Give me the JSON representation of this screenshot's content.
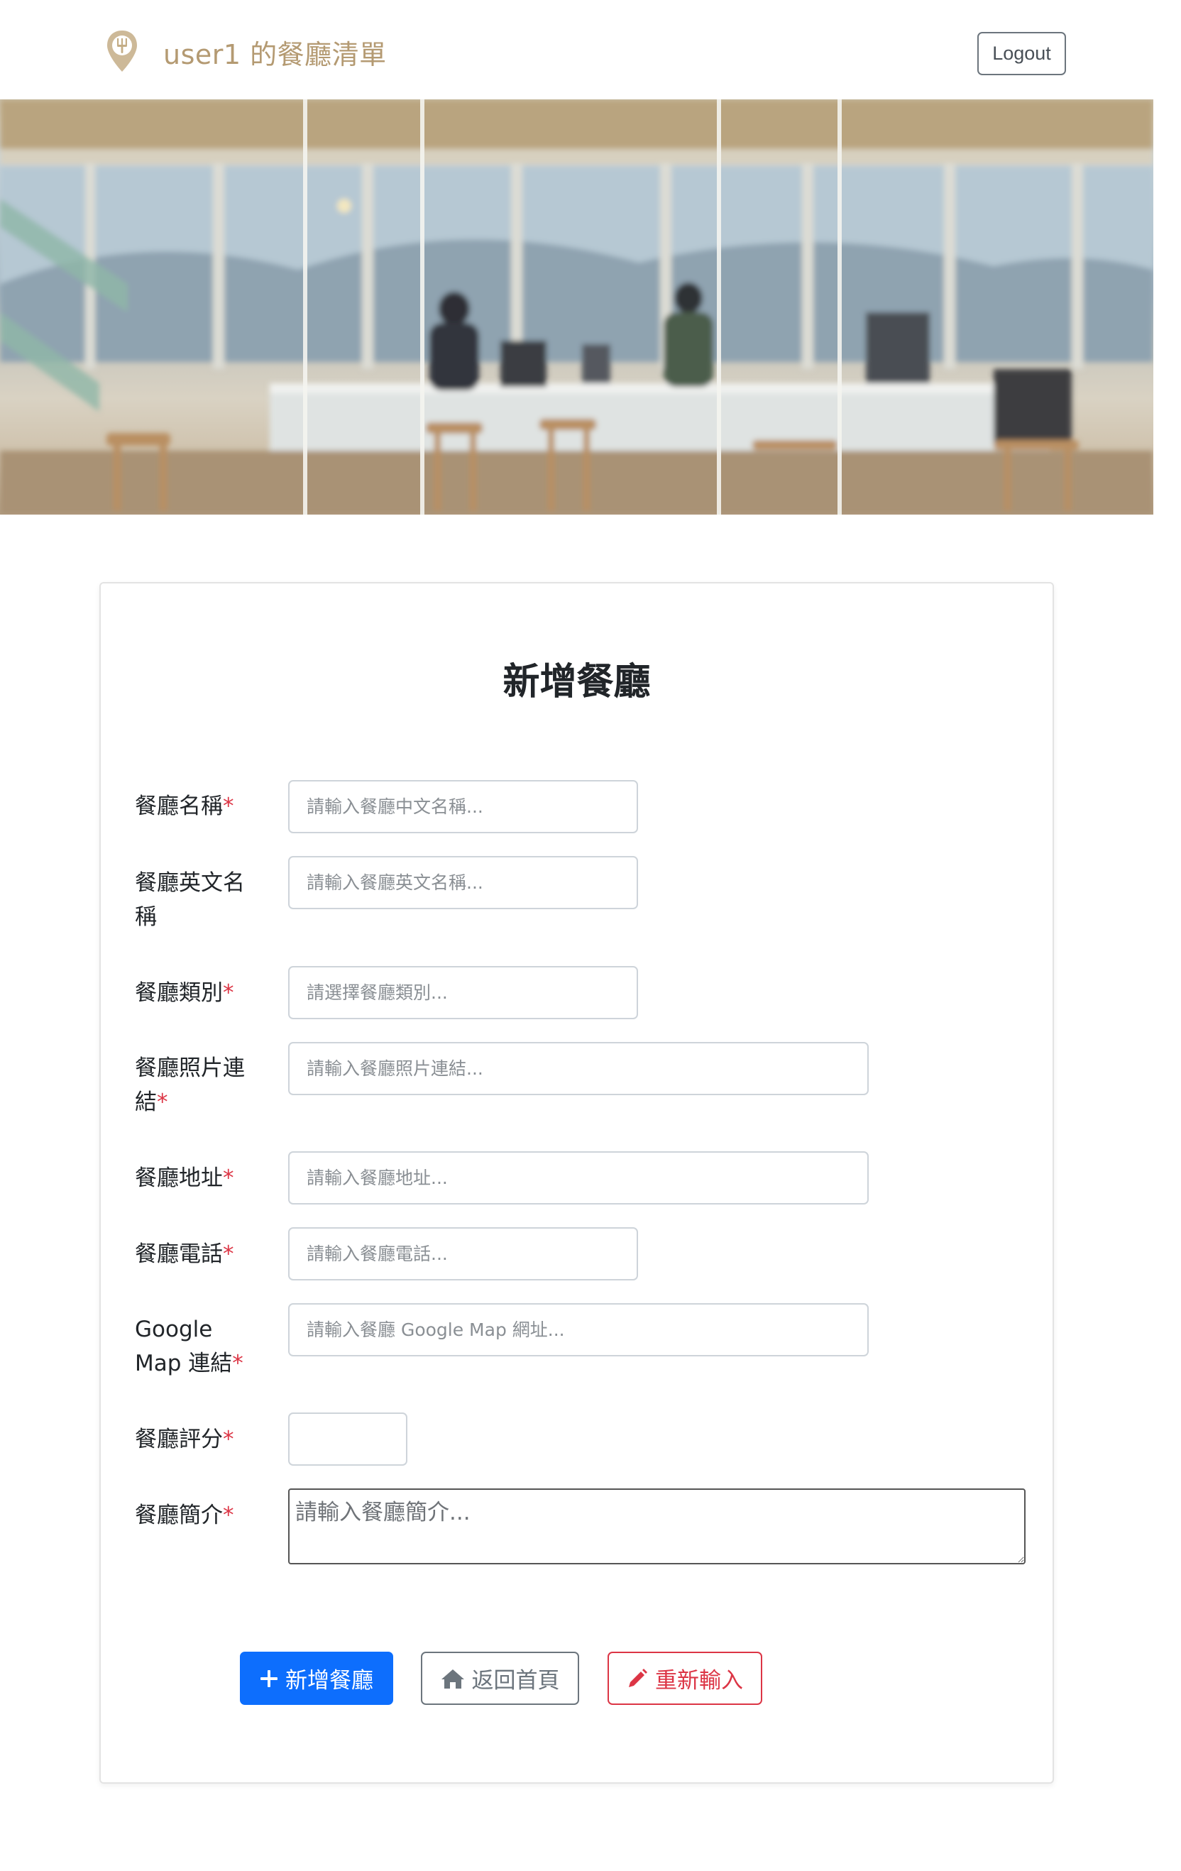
{
  "navbar": {
    "brand_text": "user1 的餐廳清單",
    "brand_color": "#b49a72",
    "logo_icon": "pin-fork-icon",
    "logout_label": "Logout"
  },
  "banner": {
    "description_icon": "restaurant-interior-image"
  },
  "form": {
    "title": "新增餐廳",
    "required_mark": "*",
    "fields": [
      {
        "label": "餐廳名稱",
        "required": true,
        "placeholder": "請輸入餐廳中文名稱..."
      },
      {
        "label": "餐廳英文名稱",
        "required": false,
        "placeholder": "請輸入餐廳英文名稱..."
      },
      {
        "label": "餐廳類別",
        "required": true,
        "placeholder": "請選擇餐廳類別..."
      },
      {
        "label": "餐廳照片連結",
        "required": true,
        "placeholder": "請輸入餐廳照片連結..."
      },
      {
        "label": "餐廳地址",
        "required": true,
        "placeholder": "請輸入餐廳地址..."
      },
      {
        "label": "餐廳電話",
        "required": true,
        "placeholder": "請輸入餐廳電話..."
      },
      {
        "label": "Google Map 連結",
        "required": true,
        "placeholder": "請輸入餐廳 Google Map 網址..."
      },
      {
        "label": "餐廳評分",
        "required": true,
        "placeholder": ""
      },
      {
        "label": "餐廳簡介",
        "required": true,
        "placeholder": "請輸入餐廳簡介..."
      }
    ],
    "buttons": {
      "submit_label": "新增餐廳",
      "submit_icon": "plus-icon",
      "back_label": "返回首頁",
      "back_icon": "home-icon",
      "reset_label": "重新輸入",
      "reset_icon": "pencil-icon"
    },
    "colors": {
      "primary": "#0d6efd",
      "secondary": "#6c757d",
      "danger": "#dc3545"
    }
  }
}
